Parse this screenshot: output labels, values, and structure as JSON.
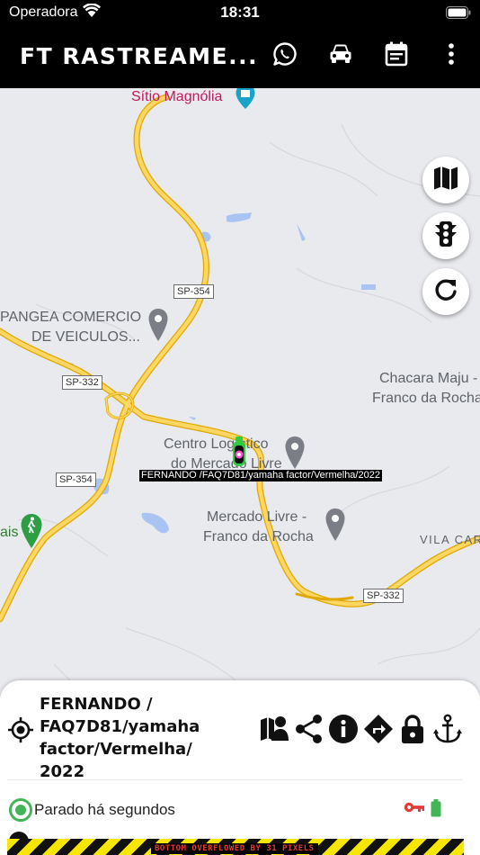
{
  "status_bar": {
    "carrier": "Operadora",
    "time": "18:31"
  },
  "app_bar": {
    "title": "FT RASTREAME...",
    "actions": [
      "whatsapp-icon",
      "car-icon",
      "calendar-icon",
      "more-vert-icon"
    ]
  },
  "map": {
    "places": {
      "sitio": "Sítio Magnólia",
      "pangea_1": "PANGEA COMERCIO",
      "pangea_2": "DE VEICULOS...",
      "chacara_1": "Chacara Maju -",
      "chacara_2": "Franco da Rocha",
      "centro_1": "Centro Logístico",
      "centro_2": "do Mercado Livre",
      "mercado_1": "Mercado Livre -",
      "mercado_2": "Franco da Rocha",
      "vila": "VILA CAR",
      "left_edge": "ais"
    },
    "road_shields": {
      "sp354_top": "SP-354",
      "sp332_left": "SP-332",
      "sp354_left": "SP-354",
      "sp332_right": "SP-332"
    },
    "vehicle_tag": "FERNANDO /FAQ7D81/yamaha factor/Vermelha/2022",
    "controls": [
      "map-icon",
      "traffic-light-icon",
      "refresh-icon"
    ]
  },
  "bottom_sheet": {
    "vehicle_name": "FERNANDO / FAQ7D81/yamaha factor/Vermelha/ 2022",
    "actions": [
      "map-person-icon",
      "share-icon",
      "info-icon",
      "directions-icon",
      "lock-icon",
      "anchor-icon"
    ],
    "status": "Parado há segundos",
    "colors": {
      "status_green": "#43b556",
      "key_red": "#e53935",
      "battery_green": "#43b556"
    }
  },
  "overflow_warning": "BOTTOM OVERFLOWED BY 31 PIXELS"
}
